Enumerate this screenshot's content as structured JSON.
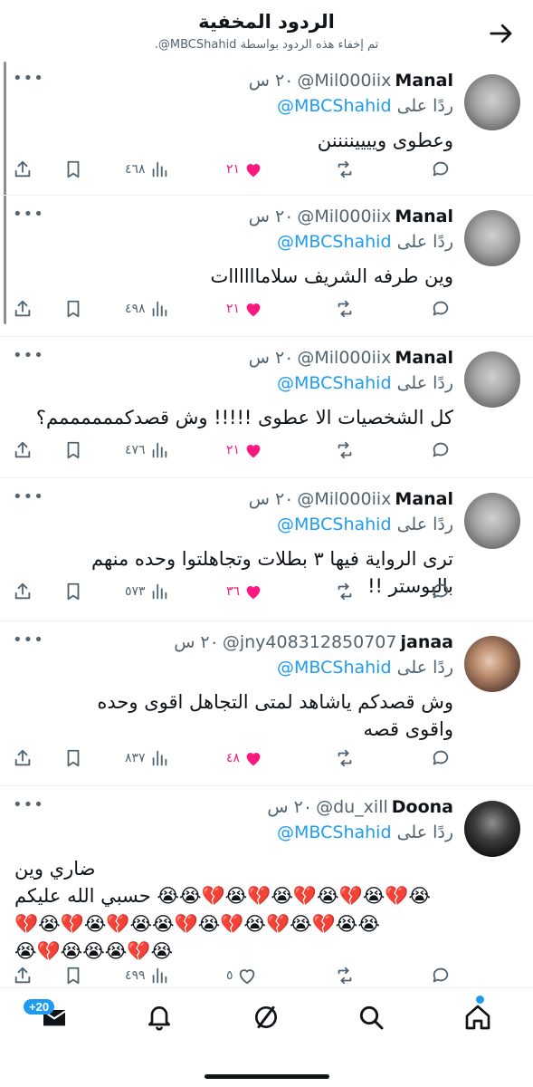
{
  "header": {
    "title": "الردود المخفية",
    "subtitle": "تم إخفاء هذه الردود بواسطة MBCShahid@."
  },
  "reply_prefix": "ردًا على",
  "reply_to": "MBCShahid@",
  "tweets": [
    {
      "name": "Manal",
      "handle": "Mil000iix@",
      "time": "٢٠ س",
      "text": "وعطوى وييييننننن",
      "likes": "٢١",
      "views": "٤٦٨",
      "liked": true
    },
    {
      "name": "Manal",
      "handle": "Mil000iix@",
      "time": "٢٠ س",
      "text": "وين طرفه الشريف سلاماااااات",
      "likes": "٢١",
      "views": "٤٩٨",
      "liked": true
    },
    {
      "name": "Manal",
      "handle": "Mil000iix@",
      "time": "٢٠ س",
      "text": "كل الشخصيات الا عطوى !!!!! وش قصدكممممممم؟",
      "likes": "٢١",
      "views": "٤٧٦",
      "liked": true
    },
    {
      "name": "Manal",
      "handle": "Mil000iix@",
      "time": "٢٠ س",
      "text": "ترى الرواية فيها ٣ بطلات وتجاهلتوا وحده منهم بالبوستر !!",
      "likes": "٣٦",
      "views": "٥٧٣",
      "liked": true
    },
    {
      "name": "janaa",
      "handle": "jny408312850707@",
      "time": "٢٠ س",
      "text": "وش قصدكم ياشاهد لمتى التجاهل اقوى وحده واقوى قصه",
      "likes": "٤٨",
      "views": "٨٣٧",
      "liked": true
    },
    {
      "name": "Doona",
      "handle": "du_xill@",
      "time": "٢٠ س",
      "text_line1": "ضاري وين",
      "text_line2": "😭💔😭💔😭💔😭💔😭💔😭😭 حسبي الله عليكم",
      "text_line3": "😭😭💔😭💔😭💔😭💔😭😭💔😭💔😭💔",
      "text_line4": "😭💔😭😭😭💔😭",
      "likes": "٥",
      "views": "٤٩٩",
      "liked": false
    }
  ],
  "bottom_nav": {
    "messages_badge": "+20",
    "items": [
      "messages-icon",
      "notifications-icon",
      "grok-icon",
      "search-icon",
      "home-icon"
    ]
  },
  "colors": {
    "accent": "#1d9bf0",
    "like": "#f91880",
    "secondary": "#536471"
  }
}
